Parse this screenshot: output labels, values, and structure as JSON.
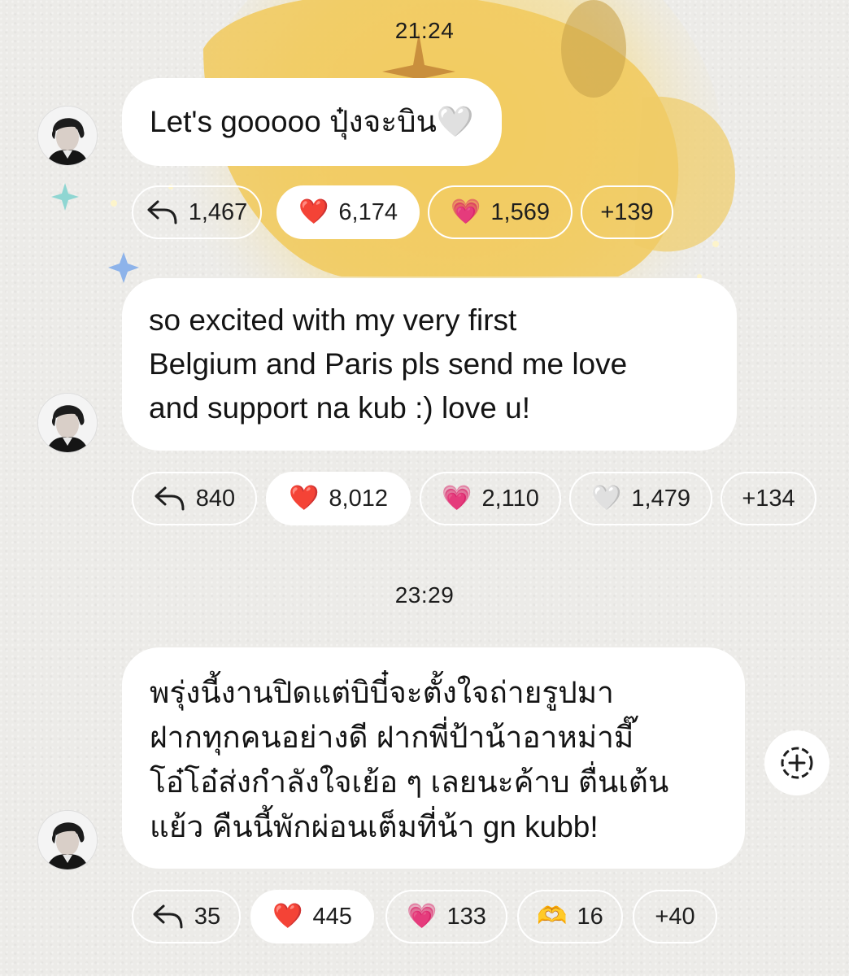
{
  "messages": [
    {
      "time": "21:24",
      "text": "Let's gooooo ปุ๋งจะบิน🤍",
      "reactions": {
        "reply": "1,467",
        "items": [
          {
            "icon": "red-heart-icon",
            "emoji": "❤️",
            "count": "6,174"
          },
          {
            "icon": "pink-heart-icon",
            "emoji": "💗",
            "count": "1,569"
          }
        ],
        "more": "+139"
      }
    },
    {
      "text_lines": [
        "so excited with my very first",
        "Belgium and Paris pls send me love",
        "and support na kub :) love u!"
      ],
      "reactions": {
        "reply": "840",
        "items": [
          {
            "icon": "red-heart-icon",
            "emoji": "❤️",
            "count": "8,012"
          },
          {
            "icon": "pink-heart-icon",
            "emoji": "💗",
            "count": "2,110"
          },
          {
            "icon": "white-heart-icon",
            "emoji": "🤍",
            "count": "1,479"
          }
        ],
        "more": "+134"
      }
    },
    {
      "time": "23:29",
      "text_lines": [
        "พรุ่งนี้งานปิดแต่บิบี๋จะตั้งใจถ่ายรูปมา",
        "ฝากทุกคนอย่างดี ฝากพี่ป้าน้าอาหม่ามี๊",
        "โอ๋โอ๋ส่งกำลังใจเย้อ ๆ เลยนะค้าบ ตื่นเต้น",
        "แย้ว คืนนี้พักผ่อนเต็มที่น้า gn kubb!"
      ],
      "reactions": {
        "reply": "35",
        "items": [
          {
            "icon": "red-heart-icon",
            "emoji": "❤️",
            "count": "445"
          },
          {
            "icon": "pink-heart-icon",
            "emoji": "💗",
            "count": "133"
          },
          {
            "icon": "heart-hands-icon",
            "emoji": "🫶",
            "count": "16"
          }
        ],
        "more": "+40"
      }
    }
  ]
}
